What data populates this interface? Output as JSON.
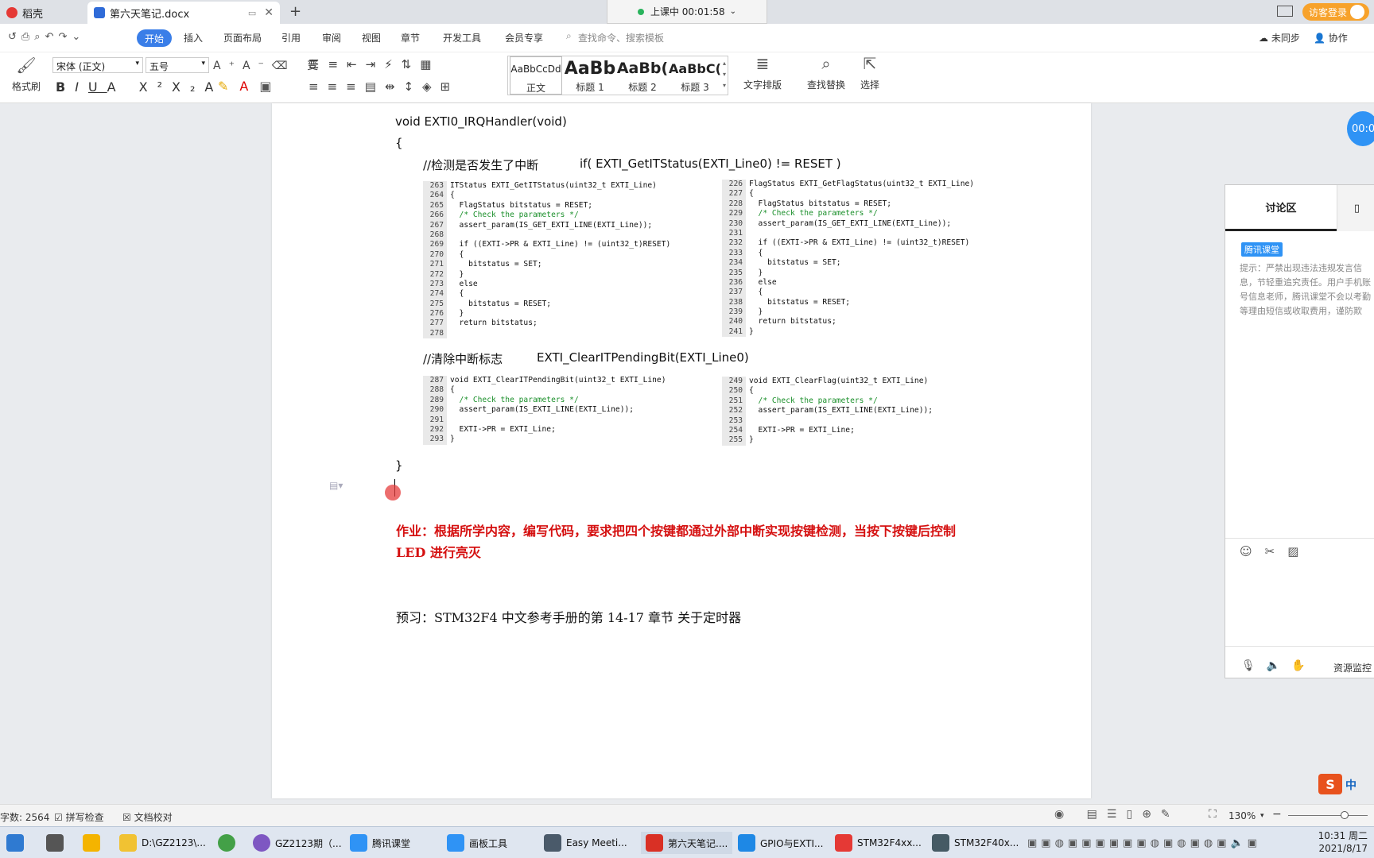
{
  "titlebar": {
    "tabs": [
      {
        "label": "稻壳",
        "icon": "daoke-icon"
      },
      {
        "label": "第六天笔记.docx",
        "icon": "word-doc-icon"
      }
    ],
    "new_tab": "+",
    "class_status": "上课中 00:01:58",
    "visitor_login": "访客登录"
  },
  "menubar": {
    "start": "开始",
    "items": [
      "插入",
      "页面布局",
      "引用",
      "审阅",
      "视图",
      "章节",
      "开发工具",
      "会员专享"
    ],
    "search_placeholder": "查找命令、搜索模板",
    "right_items": [
      "未同步",
      "协作"
    ]
  },
  "ribbon": {
    "format_painter": "格式刷",
    "font_name": "宋体 (正文)",
    "font_size": "五号",
    "styles": [
      {
        "preview": "AaBbCcDd",
        "name": "正文"
      },
      {
        "preview": "AaBb",
        "name": "标题 1"
      },
      {
        "preview": "AaBb(",
        "name": "标题 2"
      },
      {
        "preview": "AaBbC(",
        "name": "标题 3"
      }
    ],
    "text_layout": "文字排版",
    "find_replace": "查找替换",
    "select": "选择"
  },
  "document": {
    "func_header": "void EXTI0_IRQHandler(void)",
    "open_brace": "{",
    "comment1": "//检测是否发生了中断",
    "code1": "if( EXTI_GetITStatus(EXTI_Line0) != RESET )",
    "code_left_1": [
      {
        "n": "263",
        "t": "ITStatus EXTI_GetITStatus(uint32_t EXTI_Line)"
      },
      {
        "n": "264",
        "t": "{"
      },
      {
        "n": "265",
        "t": "  FlagStatus bitstatus = RESET;"
      },
      {
        "n": "266",
        "t": "  /* Check the parameters */"
      },
      {
        "n": "267",
        "t": "  assert_param(IS_GET_EXTI_LINE(EXTI_Line));"
      },
      {
        "n": "268",
        "t": ""
      },
      {
        "n": "269",
        "t": "  if ((EXTI->PR & EXTI_Line) != (uint32_t)RESET)"
      },
      {
        "n": "270",
        "t": "  {"
      },
      {
        "n": "271",
        "t": "    bitstatus = SET;"
      },
      {
        "n": "272",
        "t": "  }"
      },
      {
        "n": "273",
        "t": "  else"
      },
      {
        "n": "274",
        "t": "  {"
      },
      {
        "n": "275",
        "t": "    bitstatus = RESET;"
      },
      {
        "n": "276",
        "t": "  }"
      },
      {
        "n": "277",
        "t": "  return bitstatus;"
      },
      {
        "n": "278",
        "t": ""
      }
    ],
    "code_right_1": [
      {
        "n": "226",
        "t": "FlagStatus EXTI_GetFlagStatus(uint32_t EXTI_Line)"
      },
      {
        "n": "227",
        "t": "{"
      },
      {
        "n": "228",
        "t": "  FlagStatus bitstatus = RESET;"
      },
      {
        "n": "229",
        "t": "  /* Check the parameters */"
      },
      {
        "n": "230",
        "t": "  assert_param(IS_GET_EXTI_LINE(EXTI_Line));"
      },
      {
        "n": "231",
        "t": ""
      },
      {
        "n": "232",
        "t": "  if ((EXTI->PR & EXTI_Line) != (uint32_t)RESET)"
      },
      {
        "n": "233",
        "t": "  {"
      },
      {
        "n": "234",
        "t": "    bitstatus = SET;"
      },
      {
        "n": "235",
        "t": "  }"
      },
      {
        "n": "236",
        "t": "  else"
      },
      {
        "n": "237",
        "t": "  {"
      },
      {
        "n": "238",
        "t": "    bitstatus = RESET;"
      },
      {
        "n": "239",
        "t": "  }"
      },
      {
        "n": "240",
        "t": "  return bitstatus;"
      },
      {
        "n": "241",
        "t": "}"
      }
    ],
    "comment2": "//清除中断标志",
    "code2": "EXTI_ClearITPendingBit(EXTI_Line0)",
    "code_left_2": [
      {
        "n": "287",
        "t": "void EXTI_ClearITPendingBit(uint32_t EXTI_Line)"
      },
      {
        "n": "288",
        "t": "{"
      },
      {
        "n": "289",
        "t": "  /* Check the parameters */"
      },
      {
        "n": "290",
        "t": "  assert_param(IS_EXTI_LINE(EXTI_Line));"
      },
      {
        "n": "291",
        "t": ""
      },
      {
        "n": "292",
        "t": "  EXTI->PR = EXTI_Line;"
      },
      {
        "n": "293",
        "t": "}"
      }
    ],
    "code_right_2": [
      {
        "n": "249",
        "t": "void EXTI_ClearFlag(uint32_t EXTI_Line)"
      },
      {
        "n": "250",
        "t": "{"
      },
      {
        "n": "251",
        "t": "  /* Check the parameters */"
      },
      {
        "n": "252",
        "t": "  assert_param(IS_EXTI_LINE(EXTI_Line));"
      },
      {
        "n": "253",
        "t": ""
      },
      {
        "n": "254",
        "t": "  EXTI->PR = EXTI_Line;"
      },
      {
        "n": "255",
        "t": "}"
      }
    ],
    "close_brace": "}",
    "homework": "作业：根据所学内容，编写代码，要求把四个按键都通过外部中断实现按键检测，当按下按键后控制 LED 进行亮灭",
    "preview": "预习：STM32F4 中文参考手册的第 14-17 章节      关于定时器"
  },
  "side_panel": {
    "timer": "00:0",
    "tab_discussion": "讨论区",
    "badge": "腾讯课堂",
    "notice": "提示：严禁出现违法违规发言信息，节轻重追究责任。用户手机账号信息老师，腾讯课堂不会以考勤等理由短信或收取费用，谨防欺诈。",
    "resource_monitor": "资源监控"
  },
  "statusbar": {
    "word_count": "字数: 2564",
    "spell_check": "拼写检查",
    "doc_proof": "文档校对",
    "zoom": "130%"
  },
  "taskbar": {
    "items": [
      {
        "label": "D:\\GZ2123\\...",
        "color": "#f1c232"
      },
      {
        "label": "GZ2123期（...",
        "color": "#7e57c2"
      },
      {
        "label": "腾讯课堂",
        "color": "#2f93f5"
      },
      {
        "label": "画板工具",
        "color": "#2f93f5"
      },
      {
        "label": "Easy Meeti...",
        "color": "#4a5a6a"
      },
      {
        "label": "第六天笔记....",
        "color": "#d93025"
      },
      {
        "label": "GPIO与EXTI...",
        "color": "#1e88e5"
      },
      {
        "label": "STM32F4xx...",
        "color": "#e53935"
      },
      {
        "label": "STM32F40x...",
        "color": "#455a64"
      }
    ],
    "time": "10:31 周二",
    "date": "2021/8/17"
  }
}
